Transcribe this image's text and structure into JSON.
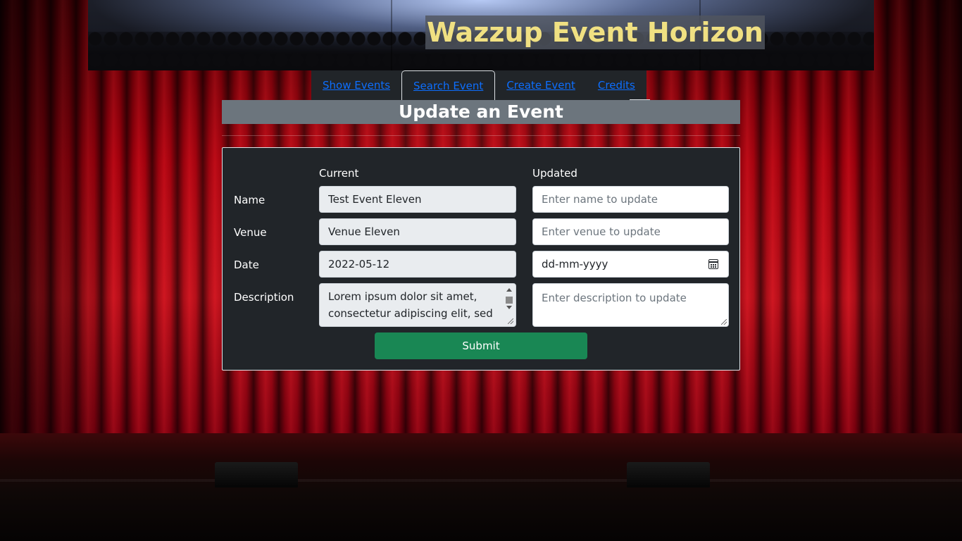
{
  "site": {
    "title": "Wazzup Event Horizon"
  },
  "nav": {
    "tabs": [
      {
        "label": "Show Events",
        "active": false
      },
      {
        "label": "Search Event",
        "active": true
      },
      {
        "label": "Create Event",
        "active": false
      },
      {
        "label": "Credits",
        "active": false
      }
    ]
  },
  "page": {
    "title": "Update an Event"
  },
  "form": {
    "columns": {
      "current": "Current",
      "updated": "Updated"
    },
    "rows": {
      "name": {
        "label": "Name",
        "current": "Test Event Eleven",
        "placeholder": "Enter name to update"
      },
      "venue": {
        "label": "Venue",
        "current": "Venue Eleven",
        "placeholder": "Enter venue to update"
      },
      "date": {
        "label": "Date",
        "current": "2022-05-12",
        "placeholder": "dd-mm-yyyy"
      },
      "description": {
        "label": "Description",
        "current": "Lorem ipsum dolor sit amet, consectetur adipiscing elit, sed",
        "placeholder": "Enter description to update"
      }
    },
    "submit_label": "Submit"
  },
  "colors": {
    "title_text": "#f0e082",
    "link": "#0d6efd",
    "card_bg": "#212529",
    "heading_bg": "#6c757d",
    "submit_bg": "#198754"
  }
}
